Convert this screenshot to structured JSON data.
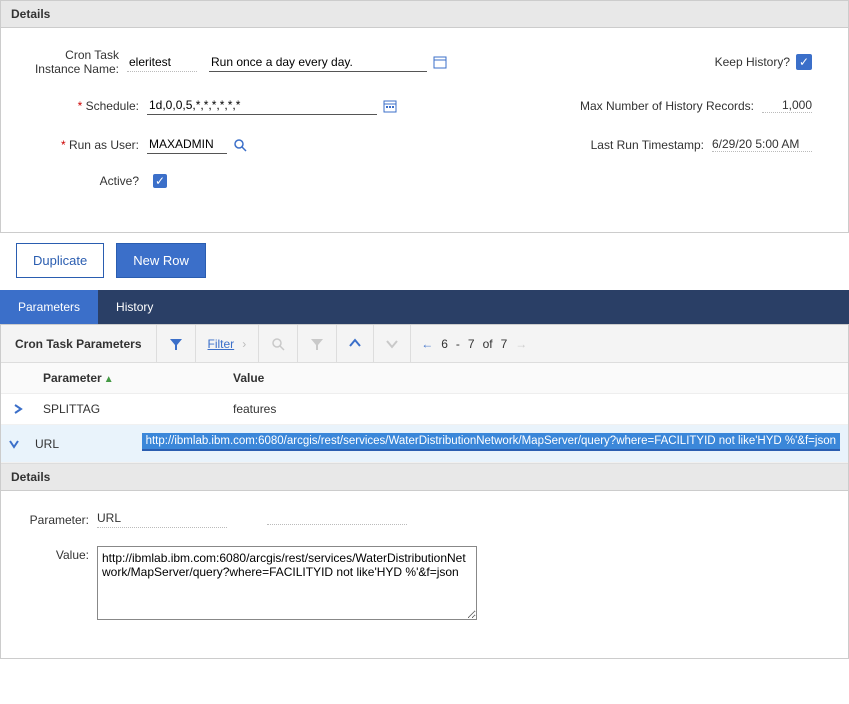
{
  "details": {
    "title": "Details",
    "labels": {
      "instanceName": "Cron Task Instance Name:",
      "schedule": "Schedule:",
      "runAsUser": "Run as User:",
      "active": "Active?",
      "keepHistory": "Keep History?",
      "maxHistory": "Max Number of History Records:",
      "lastRun": "Last Run Timestamp:"
    },
    "values": {
      "instanceName": "eleritest",
      "description": "Run once a day every day.",
      "schedule": "1d,0,0,5,*,*,*,*,*,*",
      "runAsUser": "MAXADMIN",
      "active": true,
      "keepHistory": true,
      "maxHistory": "1,000",
      "lastRun": "6/29/20 5:00 AM"
    }
  },
  "buttons": {
    "duplicate": "Duplicate",
    "newRow": "New Row"
  },
  "tabs": {
    "parameters": "Parameters",
    "history": "History"
  },
  "paramsTable": {
    "title": "Cron Task Parameters",
    "filterLabel": "Filter",
    "paging": {
      "start": "6",
      "sep": "-",
      "end": "7",
      "of": "of",
      "total": "7"
    },
    "columns": {
      "parameter": "Parameter",
      "value": "Value"
    },
    "rows": [
      {
        "parameter": "SPLITTAG",
        "value": "features",
        "expanded": false
      },
      {
        "parameter": "URL",
        "value": "http://ibmlab.ibm.com:6080/arcgis/rest/services/WaterDistributionNetwork/MapServer/query?where=FACILITYID not like'HYD %'&f=json",
        "expanded": true
      }
    ]
  },
  "paramDetails": {
    "title": "Details",
    "labels": {
      "parameter": "Parameter:",
      "value": "Value:"
    },
    "parameter": "URL",
    "value": "http://ibmlab.ibm.com:6080/arcgis/rest/services/WaterDistributionNetwork/MapServer/query?where=FACILITYID not like'HYD %'&f=json"
  }
}
